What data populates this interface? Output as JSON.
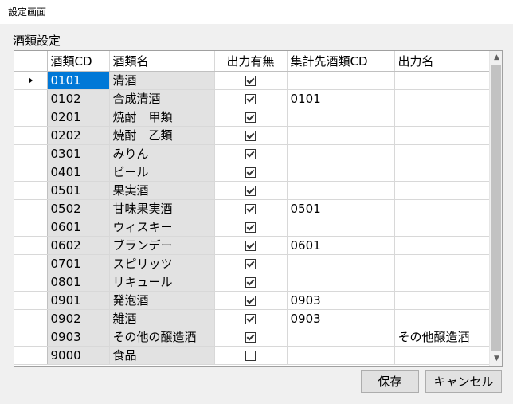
{
  "window": {
    "title": "設定画面"
  },
  "group": {
    "label": "酒類設定"
  },
  "grid": {
    "columns": [
      "酒類CD",
      "酒類名",
      "出力有無",
      "集計先酒類CD",
      "出力名"
    ],
    "rows": [
      {
        "code": "0101",
        "name": "清酒",
        "output": true,
        "aggregate": "",
        "output_name": ""
      },
      {
        "code": "0102",
        "name": "合成清酒",
        "output": true,
        "aggregate": "0101",
        "output_name": ""
      },
      {
        "code": "0201",
        "name": "焼酎　甲類",
        "output": true,
        "aggregate": "",
        "output_name": ""
      },
      {
        "code": "0202",
        "name": "焼酎　乙類",
        "output": true,
        "aggregate": "",
        "output_name": ""
      },
      {
        "code": "0301",
        "name": "みりん",
        "output": true,
        "aggregate": "",
        "output_name": ""
      },
      {
        "code": "0401",
        "name": "ビール",
        "output": true,
        "aggregate": "",
        "output_name": ""
      },
      {
        "code": "0501",
        "name": "果実酒",
        "output": true,
        "aggregate": "",
        "output_name": ""
      },
      {
        "code": "0502",
        "name": "甘味果実酒",
        "output": true,
        "aggregate": "0501",
        "output_name": ""
      },
      {
        "code": "0601",
        "name": "ウィスキー",
        "output": true,
        "aggregate": "",
        "output_name": ""
      },
      {
        "code": "0602",
        "name": "ブランデー",
        "output": true,
        "aggregate": "0601",
        "output_name": ""
      },
      {
        "code": "0701",
        "name": "スピリッツ",
        "output": true,
        "aggregate": "",
        "output_name": ""
      },
      {
        "code": "0801",
        "name": "リキュール",
        "output": true,
        "aggregate": "",
        "output_name": ""
      },
      {
        "code": "0901",
        "name": "発泡酒",
        "output": true,
        "aggregate": "0903",
        "output_name": ""
      },
      {
        "code": "0902",
        "name": "雑酒",
        "output": true,
        "aggregate": "0903",
        "output_name": ""
      },
      {
        "code": "0903",
        "name": "その他の醸造酒",
        "output": true,
        "aggregate": "",
        "output_name": "その他醸造酒"
      },
      {
        "code": "9000",
        "name": "食品",
        "output": false,
        "aggregate": "",
        "output_name": ""
      }
    ]
  },
  "buttons": {
    "save": "保存",
    "cancel": "キャンセル"
  },
  "colors": {
    "selection": "#0078d7",
    "readonly_cell": "#e2e2e2"
  },
  "icons": {
    "current_row": "row-pointer-icon",
    "scroll_up": "chevron-up-icon",
    "scroll_down": "chevron-down-icon"
  }
}
